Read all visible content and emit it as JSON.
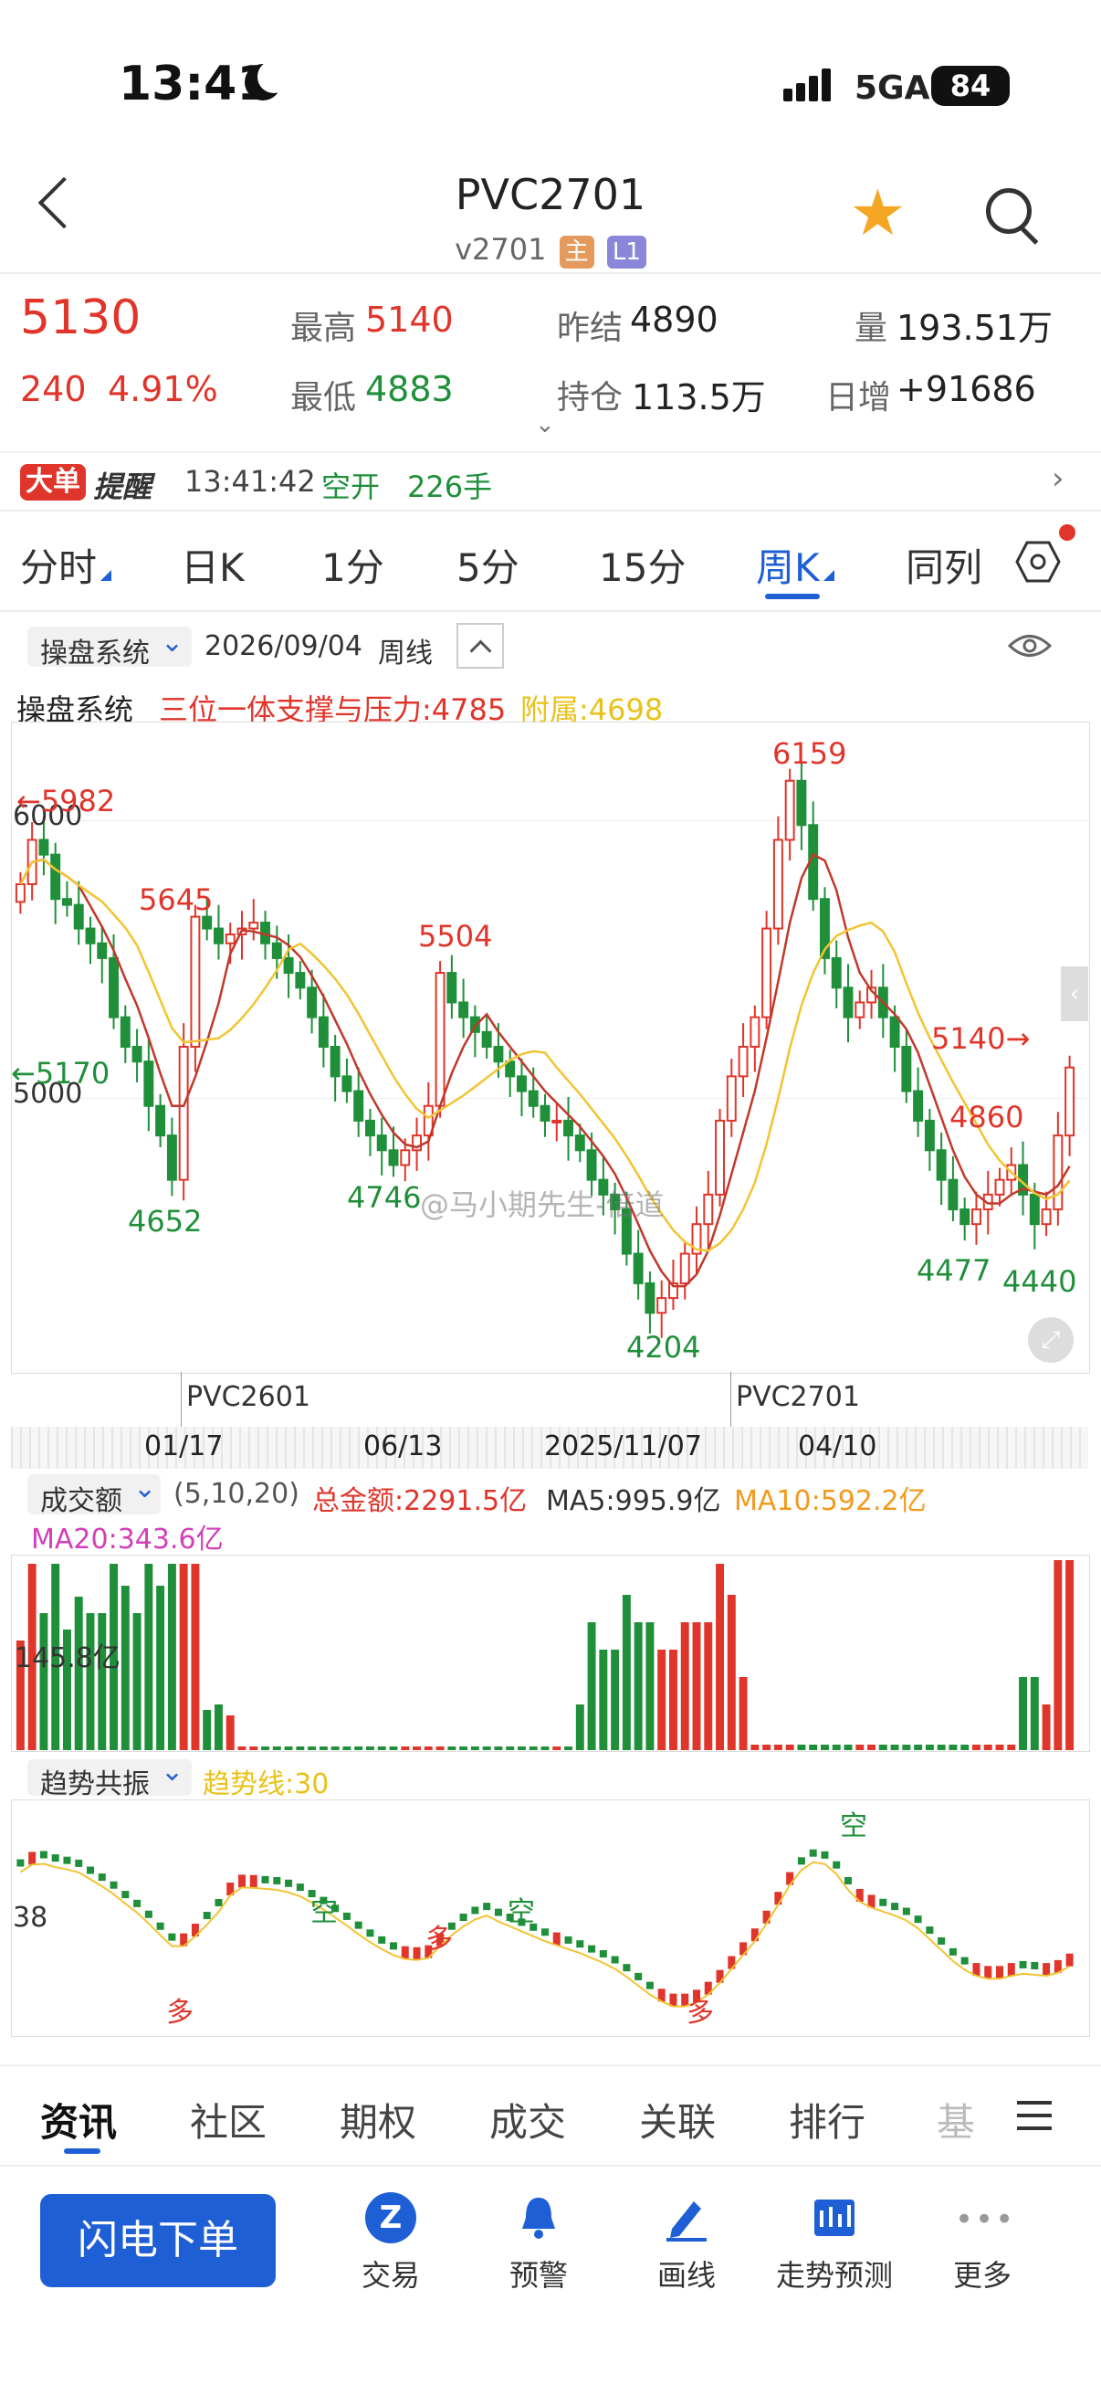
{
  "status_bar": {
    "time": "13:41",
    "network": "5GA",
    "battery": "84"
  },
  "header": {
    "title": "PVC2701",
    "subtitle": "v2701",
    "tag_main": "主",
    "tag_level": "L1"
  },
  "quote": {
    "price": "5130",
    "change": "240",
    "change_pct": "4.91%",
    "high_label": "最高",
    "high": "5140",
    "low_label": "最低",
    "low": "4883",
    "prev_settle_label": "昨结",
    "prev_settle": "4890",
    "open_interest_label": "持仓",
    "open_interest": "113.5万",
    "volume_label": "量",
    "volume": "193.51万",
    "daily_increase_label": "日增",
    "daily_increase": "+91686"
  },
  "alert": {
    "tag": "大单",
    "title": "提醒",
    "time": "13:41:42",
    "action": "空开",
    "amount": "226手"
  },
  "period_tabs": [
    "分时",
    "日K",
    "1分",
    "5分",
    "15分",
    "周K",
    "同列"
  ],
  "active_tab": "周K",
  "chart_toolbar": {
    "system": "操盘系统",
    "date": "2026/09/04",
    "period": "周线"
  },
  "indicator_line": {
    "name": "操盘系统",
    "support_label": "三位一体支撑与压力:4785",
    "aux_label": "附属:4698"
  },
  "price_labels": {
    "y6000": "6000",
    "y5000": "5000",
    "left_5982": "←5982",
    "left_5170": "←5170",
    "p5645": "5645",
    "p4652": "4652",
    "p5504": "5504",
    "p4746": "4746",
    "p4204": "4204",
    "p6159": "6159",
    "p5140": "5140→",
    "p4860": "4860",
    "p4477": "4477",
    "p4440": "4440"
  },
  "watermark": "@马小期先生-倍道",
  "contracts": [
    "PVC2601",
    "PVC2701"
  ],
  "x_dates": [
    "01/17",
    "06/13",
    "2025/11/07",
    "04/10"
  ],
  "volume_panel": {
    "name": "成交额",
    "params": "(5,10,20)",
    "total": "总金额:2291.5亿",
    "ma5": "MA5:995.9亿",
    "ma10": "MA10:592.2亿",
    "ma20": "MA20:343.6亿",
    "axis_label": "145.8亿"
  },
  "trend_panel": {
    "name": "趋势共振",
    "line": "趋势线:30",
    "axis_label": "38",
    "marks": [
      "多",
      "空",
      "多",
      "空",
      "多",
      "空"
    ]
  },
  "bottom_tabs": [
    "资讯",
    "社区",
    "期权",
    "成交",
    "关联",
    "排行",
    "基"
  ],
  "toolbar": {
    "order": "闪电下单",
    "items": [
      "交易",
      "预警",
      "画线",
      "走势预测",
      "更多"
    ]
  },
  "colors": {
    "up": "#e0352b",
    "down": "#1f8f3a",
    "accent": "#1f5fd6",
    "ma_red": "#c0392b",
    "ma_yellow": "#f2c431"
  },
  "chart_data": {
    "type": "candlestick",
    "title": "",
    "ylim": [
      4100,
      6300
    ],
    "labeled_points": [
      {
        "label": "5982",
        "value": 5982
      },
      {
        "label": "5645",
        "value": 5645
      },
      {
        "label": "4652",
        "value": 4652
      },
      {
        "label": "5504",
        "value": 5504
      },
      {
        "label": "4746",
        "value": 4746
      },
      {
        "label": "4204",
        "value": 4204
      },
      {
        "label": "6159",
        "value": 6159
      },
      {
        "label": "4477",
        "value": 4477
      },
      {
        "label": "4860",
        "value": 4860
      },
      {
        "label": "4440",
        "value": 4440
      },
      {
        "label": "5140",
        "value": 5140
      }
    ],
    "closes": [
      5750,
      5900,
      5850,
      5700,
      5680,
      5600,
      5550,
      5500,
      5300,
      5200,
      5150,
      5000,
      4900,
      4750,
      5200,
      5640,
      5600,
      5550,
      5580,
      5600,
      5620,
      5550,
      5500,
      5450,
      5400,
      5300,
      5200,
      5100,
      5050,
      4950,
      4900,
      4850,
      4800,
      4850,
      4900,
      5000,
      5450,
      5350,
      5300,
      5250,
      5200,
      5150,
      5100,
      5050,
      5000,
      4950,
      4950,
      4900,
      4850,
      4750,
      4700,
      4650,
      4500,
      4400,
      4300,
      4350,
      4400,
      4500,
      4600,
      4700,
      4950,
      5100,
      5200,
      5300,
      5600,
      5900,
      6100,
      5950,
      5700,
      5500,
      5400,
      5300,
      5350,
      5400,
      5300,
      5200,
      5050,
      4950,
      4850,
      4750,
      4650,
      4600,
      4650,
      4700,
      4750,
      4800,
      4700,
      4600,
      4650,
      4900,
      5130
    ]
  }
}
